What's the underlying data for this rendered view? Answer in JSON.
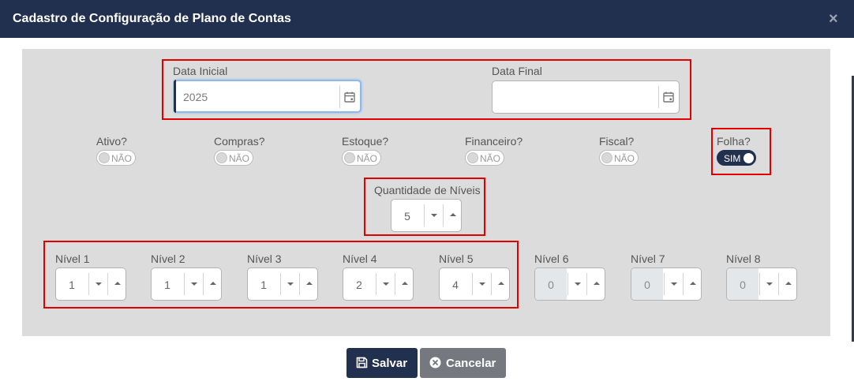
{
  "dialog": {
    "title": "Cadastro de Configuração de Plano de Contas",
    "close_label": "×"
  },
  "dates": {
    "start": {
      "label": "Data Inicial",
      "value": "2025"
    },
    "end": {
      "label": "Data Final",
      "value": ""
    }
  },
  "toggles": [
    {
      "label": "Ativo?",
      "state": "NÃO",
      "on": false
    },
    {
      "label": "Compras?",
      "state": "NÃO",
      "on": false
    },
    {
      "label": "Estoque?",
      "state": "NÃO",
      "on": false
    },
    {
      "label": "Financeiro?",
      "state": "NÃO",
      "on": false
    },
    {
      "label": "Fiscal?",
      "state": "NÃO",
      "on": false
    },
    {
      "label": "Folha?",
      "state": "SIM",
      "on": true
    }
  ],
  "levels_count": {
    "label": "Quantidade de Níveis",
    "value": "5"
  },
  "levels": [
    {
      "label": "Nível 1",
      "value": "1",
      "enabled": true
    },
    {
      "label": "Nível 2",
      "value": "1",
      "enabled": true
    },
    {
      "label": "Nível 3",
      "value": "1",
      "enabled": true
    },
    {
      "label": "Nível 4",
      "value": "2",
      "enabled": true
    },
    {
      "label": "Nível 5",
      "value": "4",
      "enabled": true
    },
    {
      "label": "Nível 6",
      "value": "0",
      "enabled": false
    },
    {
      "label": "Nível 7",
      "value": "0",
      "enabled": false
    },
    {
      "label": "Nível 8",
      "value": "0",
      "enabled": false
    }
  ],
  "footer": {
    "save_label": "Salvar",
    "cancel_label": "Cancelar"
  },
  "colors": {
    "header": "#22304f",
    "highlight": "#e00000",
    "panel": "#dcdcdc",
    "cancel": "#75797f"
  }
}
